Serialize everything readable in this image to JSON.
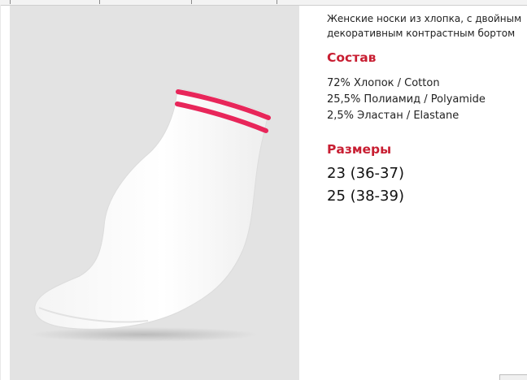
{
  "product": {
    "description": "Женские носки из хлопка, с двойным декоративным контрастным бортом",
    "image_icon": "white-sock-with-red-stripes",
    "stripe_color": "#e8265a",
    "accent_color": "#c81e32"
  },
  "composition": {
    "title": "Состав",
    "items": [
      "72% Хлопок / Cotton",
      "25,5% Полиамид / Polyamide",
      "2,5% Эластан / Elastane"
    ]
  },
  "sizes": {
    "title": "Размеры",
    "items": [
      "23 (36-37)",
      "25 (38-39)"
    ]
  }
}
